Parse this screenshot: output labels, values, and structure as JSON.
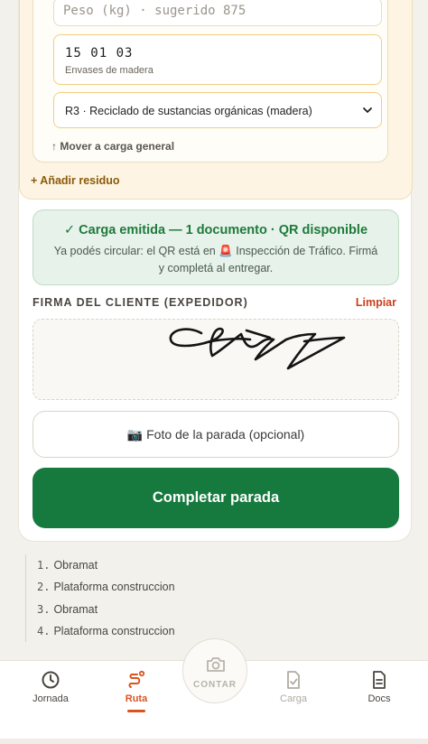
{
  "waste": {
    "weight_placeholder": "Peso (kg) · sugerido 875",
    "code": "15 01 03",
    "code_description": "Envases de madera",
    "treatment_selected": "R3 · Reciclado de sustancias orgánicas (madera)",
    "move_link": "↑ Mover a carga general",
    "add_label": "+ Añadir residuo"
  },
  "status": {
    "title": "✓ Carga emitida — 1 documento · QR disponible",
    "body": "Ya podés circular: el QR está en 🚨 Inspección de Tráfico. Firmá y completá al entregar."
  },
  "signature": {
    "label": "FIRMA DEL CLIENTE (EXPEDIDOR)",
    "clear": "Limpiar"
  },
  "photo_button": "📷 Foto de la parada (opcional)",
  "complete_button": "Completar parada",
  "stops": [
    {
      "num": "1.",
      "name": "Obramat"
    },
    {
      "num": "2.",
      "name": "Plataforma construccion"
    },
    {
      "num": "3.",
      "name": "Obramat"
    },
    {
      "num": "4.",
      "name": "Plataforma construccion"
    }
  ],
  "nav": {
    "jornada": "Jornada",
    "ruta": "Ruta",
    "contar": "CONTAR",
    "carga": "Carga",
    "docs": "Docs"
  },
  "colors": {
    "accent": "#d9541e",
    "primary_green": "#167a3e",
    "success_bg": "#e7f2ea",
    "panel_bg": "#fdf4e3"
  }
}
